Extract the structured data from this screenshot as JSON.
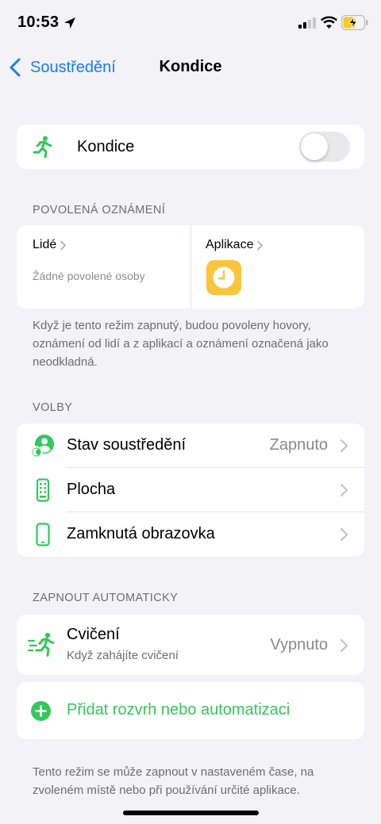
{
  "status_bar": {
    "time": "10:53"
  },
  "nav": {
    "back_label": "Soustředění",
    "title": "Kondice"
  },
  "mode": {
    "label": "Kondice",
    "toggle_on": false
  },
  "allowed_notifications": {
    "header": "POVOLENÁ OZNÁMENÍ",
    "people_title": "Lidé",
    "people_subtitle": "Žádné povolené osoby",
    "apps_title": "Aplikace",
    "apps": [
      {
        "icon": "clock-app-icon",
        "color": "#f9c53b"
      }
    ],
    "footer": "Když je tento režim zapnutý, budou povoleny hovory, oznámení od lidí a z aplikací a oznámení označená jako neodkladná."
  },
  "options": {
    "header": "VOLBY",
    "rows": [
      {
        "label": "Stav soustředění",
        "value": "Zapnuto",
        "icon": "focus-status-icon"
      },
      {
        "label": "Plocha",
        "value": "",
        "icon": "home-screen-icon"
      },
      {
        "label": "Zamknutá obrazovka",
        "value": "",
        "icon": "lock-screen-icon"
      }
    ]
  },
  "auto": {
    "header": "ZAPNOUT AUTOMATICKY",
    "row": {
      "label": "Cvičení",
      "subtitle": "Když zahájíte cvičení",
      "value": "Vypnuto",
      "icon": "workout-icon"
    },
    "add_label": "Přidat rozvrh nebo automatizaci",
    "footer": "Tento režim se může zapnout v nastaveném čase, na zvoleném místě nebo při používání určité aplikace."
  },
  "colors": {
    "accent_blue": "#1a7cf5",
    "accent_green": "#34c759",
    "background": "#f2f2f7"
  }
}
